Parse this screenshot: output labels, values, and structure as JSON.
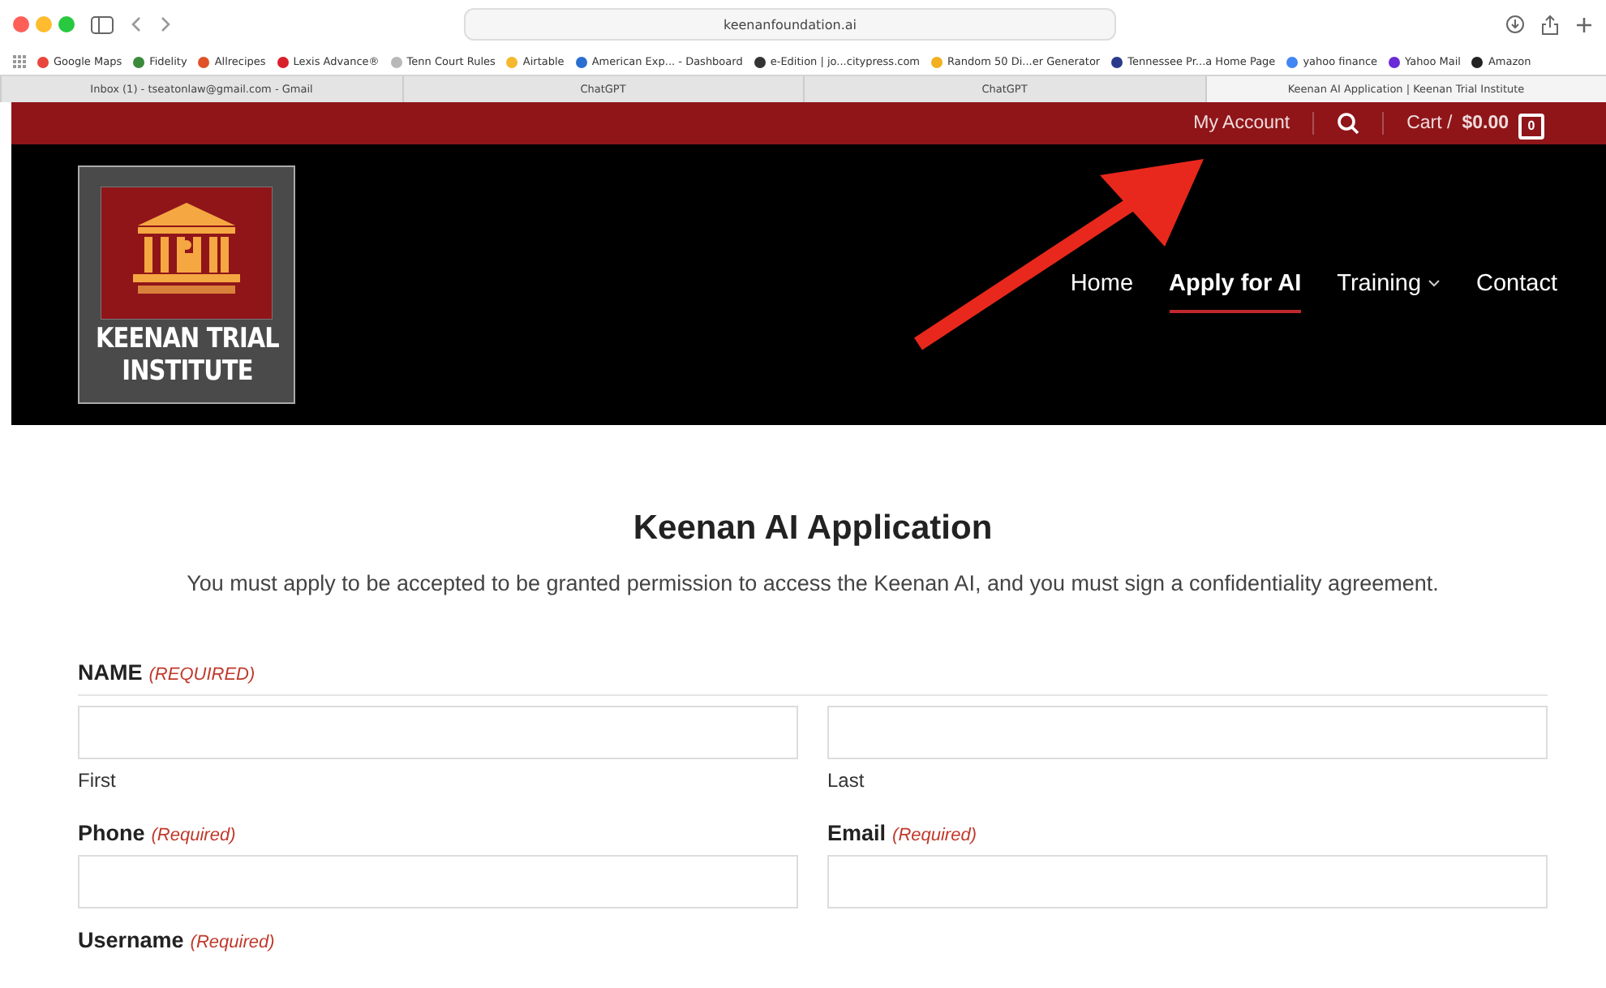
{
  "browser": {
    "url": "keenanfoundation.ai",
    "bookmarks": [
      {
        "label": "Google Maps",
        "color": "#e8453c"
      },
      {
        "label": "Fidelity",
        "color": "#3a8a3a"
      },
      {
        "label": "Allrecipes",
        "color": "#e0522a"
      },
      {
        "label": "Lexis Advance®",
        "color": "#d8202a"
      },
      {
        "label": "Tenn Court Rules",
        "color": "#b8b8b8"
      },
      {
        "label": "Airtable",
        "color": "#f5b82e"
      },
      {
        "label": "American Exp... - Dashboard",
        "color": "#2a6fd0"
      },
      {
        "label": "e-Edition | jo...citypress.com",
        "color": "#333333"
      },
      {
        "label": "Random 50 Di...er Generator",
        "color": "#f0b020"
      },
      {
        "label": "Tennessee Pr...a Home Page",
        "color": "#2a3a8a"
      },
      {
        "label": "yahoo finance",
        "color": "#4285f4"
      },
      {
        "label": "Yahoo Mail",
        "color": "#6a2ad8"
      },
      {
        "label": "Amazon",
        "color": "#222222"
      }
    ],
    "tabs": [
      {
        "label": "Inbox (1) - tseatonlaw@gmail.com - Gmail",
        "selected": false
      },
      {
        "label": "ChatGPT",
        "selected": false
      },
      {
        "label": "ChatGPT",
        "selected": false
      },
      {
        "label": "Keenan AI Application | Keenan Trial Institute",
        "selected": true
      }
    ]
  },
  "top_bar": {
    "my_account": "My Account",
    "cart_label": "Cart /",
    "cart_total": "$0.00",
    "cart_count": "0"
  },
  "logo": {
    "line_1": "KEENAN TRIAL",
    "line_2": "INSTITUTE"
  },
  "nav": [
    {
      "label": "Home",
      "selected": false,
      "has_dropdown": false
    },
    {
      "label": "Apply for AI",
      "selected": true,
      "has_dropdown": false
    },
    {
      "label": "Training",
      "selected": false,
      "has_dropdown": true
    },
    {
      "label": "Contact",
      "selected": false,
      "has_dropdown": false
    }
  ],
  "form": {
    "title": "Keenan AI Application",
    "intro": "You must apply to be accepted to be granted permission to access the Keenan AI, and you must sign a confidentiality agreement.",
    "rows": [
      {
        "kind": "group",
        "label": "NAME",
        "required": "(REQUIRED)",
        "subfields": [
          {
            "sublabel": "First"
          },
          {
            "sublabel": "Last"
          }
        ]
      },
      {
        "kind": "pair",
        "fields": [
          {
            "label": "Phone",
            "required": "(Required)"
          },
          {
            "label": "Email",
            "required": "(Required)"
          }
        ]
      },
      {
        "kind": "heading",
        "label": "Username",
        "required": "(Required)"
      }
    ]
  }
}
